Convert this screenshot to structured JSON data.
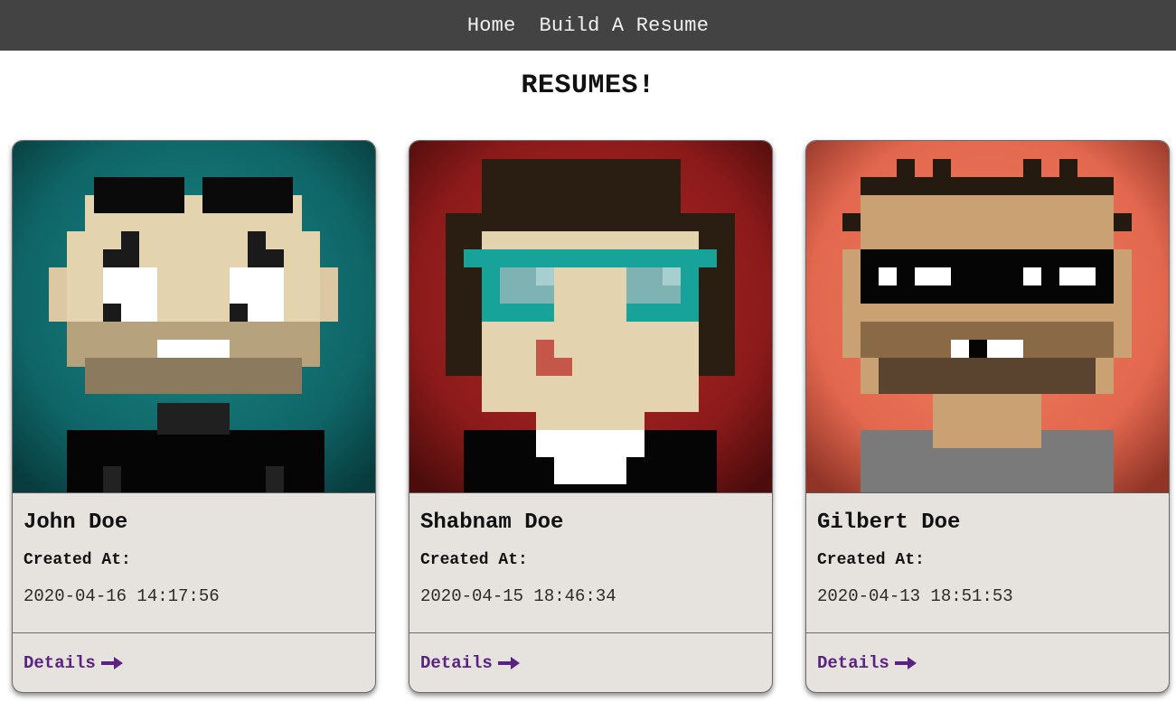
{
  "nav": {
    "home": "Home",
    "build": "Build A Resume"
  },
  "page_title": "RESUMES!",
  "cards": [
    {
      "name": "John Doe",
      "created_label": "Created At:",
      "created_at": "2020-04-16 14:17:56",
      "details_label": "Details",
      "avatar_icon": "pixel-avatar-bald-beard-icon",
      "background_color": "#0f6466"
    },
    {
      "name": "Shabnam Doe",
      "created_label": "Created At:",
      "created_at": "2020-04-15 18:46:34",
      "details_label": "Details",
      "avatar_icon": "pixel-avatar-teal-glasses-icon",
      "background_color": "#8b1a1a"
    },
    {
      "name": "Gilbert Doe",
      "created_label": "Created At:",
      "created_at": "2020-04-13 18:51:53",
      "details_label": "Details",
      "avatar_icon": "pixel-avatar-sunglasses-icon",
      "background_color": "#e2674e"
    }
  ],
  "colors": {
    "navbar": "#434343",
    "card_background": "#e6e2dd",
    "link": "#5a2382"
  }
}
